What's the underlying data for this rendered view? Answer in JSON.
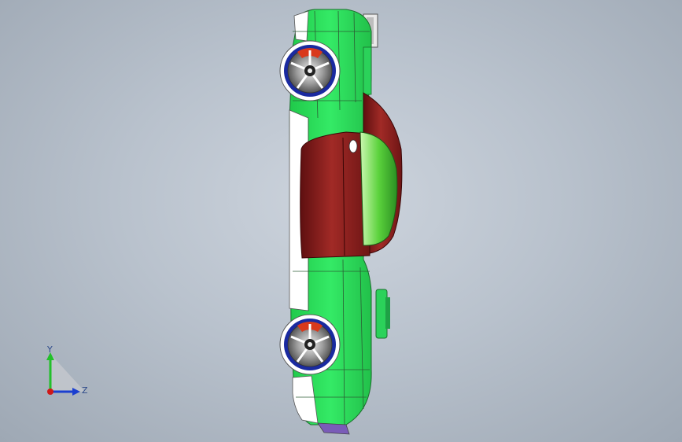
{
  "viewport": {
    "background_top": "#cdd4dd",
    "background_bottom": "#9ea8b4"
  },
  "model": {
    "body_color": "#2be05a",
    "canopy_color": "#8a1f1f",
    "accent_color": "#ffffff",
    "wheel_rim_color": "#1a2aa0",
    "caliper_color": "#d9391c"
  },
  "triad": {
    "y_label": "Y",
    "z_label": "Z",
    "y_color": "#22c02a",
    "z_color": "#1b3fd0",
    "origin_color": "#d01818"
  }
}
